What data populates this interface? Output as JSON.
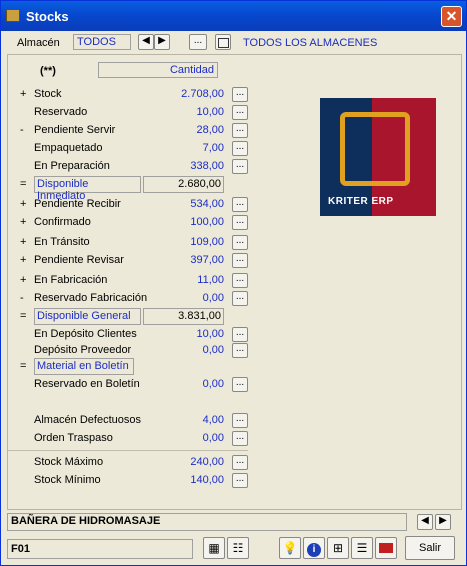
{
  "window": {
    "title": "Stocks",
    "close_icon": "close-icon"
  },
  "top": {
    "almacen_label": "Almacén",
    "almacen_value": "TODOS",
    "prev_icon": "◀",
    "next_icon": "▶",
    "dots": "...",
    "calendar_icon": "calendar-icon",
    "almacen_desc": "TODOS LOS ALMACENES"
  },
  "panel": {
    "header_mark": "(**)",
    "header_col": "Cantidad",
    "rows": [
      {
        "sign": "+",
        "label": "Stock",
        "value": "2.708,00",
        "btn": "..."
      },
      {
        "sign": "",
        "label": "Reservado",
        "value": "10,00",
        "btn": "..."
      },
      {
        "sign": "-",
        "label": "Pendiente Servir",
        "value": "28,00",
        "btn": "..."
      },
      {
        "sign": "",
        "label": "Empaquetado",
        "value": "7,00",
        "btn": "..."
      },
      {
        "sign": "",
        "label": "En Preparación",
        "value": "338,00",
        "btn": "..."
      },
      {
        "sign": "=",
        "label": "Disponible Inmediato",
        "value": "2.680,00"
      },
      {
        "sign": "+",
        "label": "Pendiente Recibir",
        "value": "534,00",
        "btn": "..."
      },
      {
        "sign": "+",
        "label": "Confirmado",
        "value": "100,00",
        "btn": "..."
      },
      {
        "sign": "+",
        "label": "En Tránsito",
        "value": "109,00",
        "btn": "..."
      },
      {
        "sign": "+",
        "label": "Pendiente Revisar",
        "value": "397,00",
        "btn": "..."
      },
      {
        "sign": "+",
        "label": "En Fabricación",
        "value": "11,00",
        "btn": "..."
      },
      {
        "sign": "-",
        "label": "Reservado Fabricación",
        "value": "0,00",
        "btn": "..."
      },
      {
        "sign": "=",
        "label": "Disponible General",
        "value": "3.831,00"
      },
      {
        "sign": "",
        "label": "En Depósito Clientes",
        "value": "10,00",
        "btn": "..."
      },
      {
        "sign": "",
        "label": "Depósito Proveedor",
        "value": "0,00",
        "btn": "..."
      },
      {
        "sign": "=",
        "label": "Material en Boletín",
        "value": ""
      },
      {
        "sign": "",
        "label": "Reservado en Boletín",
        "value": "0,00",
        "btn": "..."
      },
      {
        "sign": "",
        "label": "Almacén Defectuosos",
        "value": "4,00",
        "btn": "..."
      },
      {
        "sign": "",
        "label": "Orden Traspaso",
        "value": "0,00",
        "btn": "..."
      },
      {
        "sign": "",
        "label": "Stock Máximo",
        "value": "240,00",
        "btn": "..."
      },
      {
        "sign": "",
        "label": "Stock Mínimo",
        "value": "140,00",
        "btn": "..."
      }
    ]
  },
  "logo": {
    "text": "KRITER ERP"
  },
  "bottom": {
    "article": "BAÑERA DE HIDROMASAJE",
    "code": "F01",
    "salir": "Salir"
  }
}
